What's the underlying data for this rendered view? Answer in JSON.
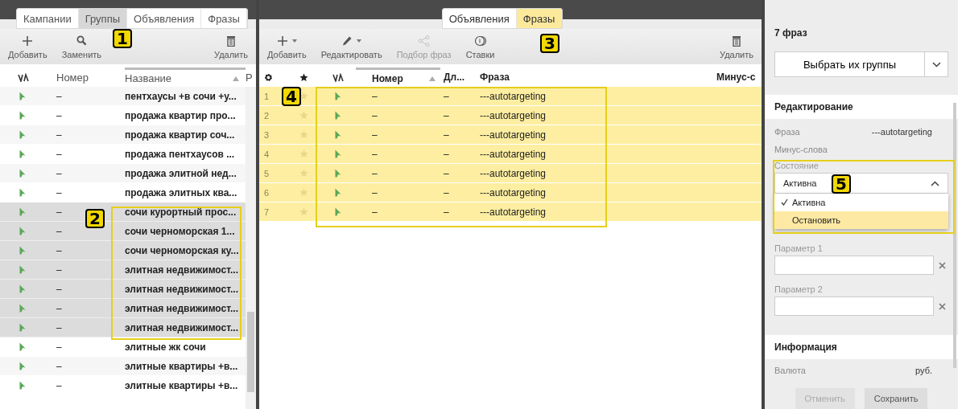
{
  "left_panel": {
    "tabs": [
      {
        "label": "Кампании",
        "selected": false
      },
      {
        "label": "Группы",
        "selected": true
      },
      {
        "label": "Объявления",
        "selected": false
      },
      {
        "label": "Фразы",
        "selected": false
      }
    ],
    "toolbar": {
      "actions": [
        {
          "label": "Добавить",
          "kind": "plus"
        },
        {
          "label": "Заменить",
          "kind": "search"
        }
      ],
      "end_action": {
        "label": "Удалить",
        "kind": "trash"
      }
    },
    "columns": [
      "Номер",
      "Название",
      "Р"
    ],
    "rows": [
      {
        "number": "–",
        "name": "пентхаусы +в сочи +у...",
        "selected": false
      },
      {
        "number": "–",
        "name": "продажа квартир про...",
        "selected": false
      },
      {
        "number": "–",
        "name": "продажа квартир соч...",
        "selected": false
      },
      {
        "number": "–",
        "name": "продажа пентхаусов ...",
        "selected": false
      },
      {
        "number": "–",
        "name": "продажа элитной нед...",
        "selected": false
      },
      {
        "number": "–",
        "name": "продажа элитных ква...",
        "selected": false
      },
      {
        "number": "–",
        "name": "сочи курортный прос...",
        "selected": true
      },
      {
        "number": "–",
        "name": "сочи черноморская 1...",
        "selected": true
      },
      {
        "number": "–",
        "name": "сочи черноморская ку...",
        "selected": true
      },
      {
        "number": "–",
        "name": "элитная недвижимост...",
        "selected": true
      },
      {
        "number": "–",
        "name": "элитная недвижимост...",
        "selected": true
      },
      {
        "number": "–",
        "name": "элитная недвижимост...",
        "selected": true
      },
      {
        "number": "–",
        "name": "элитная недвижимост...",
        "selected": true
      },
      {
        "number": "–",
        "name": "элитные жк сочи",
        "selected": false
      },
      {
        "number": "–",
        "name": "элитные квартиры +в...",
        "selected": false
      },
      {
        "number": "–",
        "name": "элитные квартиры +в...",
        "selected": false
      }
    ]
  },
  "middle_panel": {
    "tabs": [
      {
        "label": "Объявления",
        "selected": false
      },
      {
        "label": "Фразы",
        "selected": true
      }
    ],
    "toolbar": {
      "actions": [
        {
          "label": "Добавить",
          "kind": "plus",
          "dropdown": true,
          "disabled": false
        },
        {
          "label": "Редактировать",
          "kind": "pencil",
          "dropdown": true,
          "disabled": false
        },
        {
          "label": "Подбор фраз",
          "kind": "share",
          "dropdown": false,
          "disabled": true
        },
        {
          "label": "Ставки",
          "kind": "coins",
          "dropdown": false,
          "disabled": false
        }
      ],
      "end_action": {
        "label": "Удалить",
        "kind": "trash"
      }
    },
    "columns": [
      "Номер",
      "Дл...",
      "Фраза",
      "Минус-с"
    ],
    "rows": [
      {
        "index": "1",
        "number": "–",
        "length": "–",
        "phrase": "---autotargeting",
        "selected": true
      },
      {
        "index": "2",
        "number": "–",
        "length": "–",
        "phrase": "---autotargeting",
        "selected": true
      },
      {
        "index": "3",
        "number": "–",
        "length": "–",
        "phrase": "---autotargeting",
        "selected": true
      },
      {
        "index": "4",
        "number": "–",
        "length": "–",
        "phrase": "---autotargeting",
        "selected": true
      },
      {
        "index": "5",
        "number": "–",
        "length": "–",
        "phrase": "---autotargeting",
        "selected": true
      },
      {
        "index": "6",
        "number": "–",
        "length": "–",
        "phrase": "---autotargeting",
        "selected": true
      },
      {
        "index": "7",
        "number": "–",
        "length": "–",
        "phrase": "---autotargeting",
        "selected": true
      }
    ]
  },
  "right_panel": {
    "title": "7 фраз",
    "select_groups_button": "Выбрать их группы",
    "editing": {
      "heading": "Редактирование",
      "phrase_label": "Фраза",
      "phrase_value": "---autotargeting",
      "minus_words_label": "Минус-слова",
      "state_label": "Состояние",
      "state_value": "Активна",
      "state_options": [
        {
          "label": "Активна",
          "selected": true,
          "highlighted": false
        },
        {
          "label": "Остановить",
          "selected": false,
          "highlighted": true
        }
      ],
      "params": [
        {
          "label": "Параметр 1"
        },
        {
          "label": "Параметр 2"
        }
      ]
    },
    "info": {
      "heading": "Информация",
      "rows": [
        {
          "label": "Валюта",
          "value": "руб."
        }
      ]
    },
    "buttons": [
      {
        "label": "Отменить",
        "disabled": true
      },
      {
        "label": "Сохранить",
        "disabled": false
      }
    ]
  },
  "callouts": [
    {
      "label": "1"
    },
    {
      "label": "2"
    },
    {
      "label": "3"
    },
    {
      "label": "4"
    },
    {
      "label": "5"
    }
  ]
}
